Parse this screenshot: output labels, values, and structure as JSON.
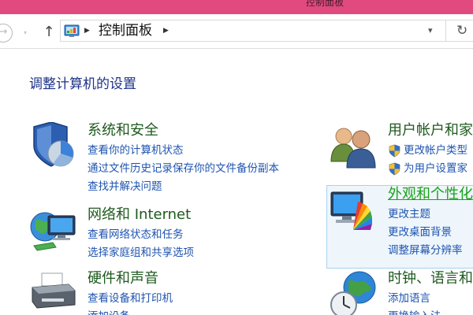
{
  "window": {
    "title": "控制面板"
  },
  "navbar": {
    "back_glyph": "→",
    "forward_glyph": "▾",
    "up_glyph": "↑",
    "address": {
      "separator": "▶",
      "breadcrumb": "控制面板",
      "dropdown_glyph": "▾",
      "refresh_glyph": "↻"
    }
  },
  "page": {
    "title": "调整计算机的设置"
  },
  "categories": {
    "system": {
      "title": "系统和安全",
      "icon": "shield-pie-icon",
      "links": [
        "查看你的计算机状态",
        "通过文件历史记录保存你的文件备份副本",
        "查找并解决问题"
      ]
    },
    "network": {
      "title": "网络和 Internet",
      "icon": "network-globe-icon",
      "links": [
        "查看网络状态和任务",
        "选择家庭组和共享选项"
      ]
    },
    "hardware": {
      "title": "硬件和声音",
      "icon": "printer-icon",
      "links": [
        "查看设备和打印机",
        "添加设备"
      ]
    },
    "users": {
      "title": "用户帐户和家",
      "icon": "users-icon",
      "links": [
        "更改帐户类型",
        "为用户设置家"
      ]
    },
    "appearance": {
      "title": "外观和个性化",
      "icon": "monitor-palette-icon",
      "links": [
        "更改主题",
        "更改桌面背景",
        "调整屏幕分辨率"
      ]
    },
    "clock": {
      "title": "时钟、语言和",
      "icon": "clock-globe-icon",
      "links": [
        "添加语言",
        "更换输入法"
      ]
    }
  },
  "colors": {
    "titlebar": "#e04a7e",
    "category_title": "#1e5a1e",
    "link": "#1f54b0",
    "page_title": "#1e3287",
    "hover_title": "#1aa21a"
  }
}
